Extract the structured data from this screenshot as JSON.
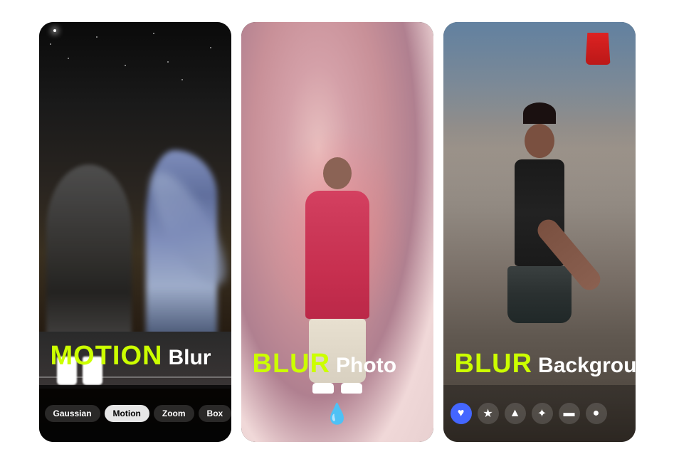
{
  "cards": [
    {
      "id": "card-motion-blur",
      "title_accent": "MOTION",
      "title_normal": "Blur",
      "tabs": [
        {
          "label": "Gaussian",
          "active": false
        },
        {
          "label": "Motion",
          "active": true
        },
        {
          "label": "Zoom",
          "active": false
        },
        {
          "label": "Box",
          "active": false
        }
      ]
    },
    {
      "id": "card-blur-photo",
      "title_accent": "BLUR",
      "title_normal": "Photo",
      "bottom_icon": "droplet"
    },
    {
      "id": "card-blur-background",
      "title_accent": "BLUR",
      "title_normal": "Background",
      "bottom_icons": [
        {
          "name": "heart",
          "symbol": "♥"
        },
        {
          "name": "star",
          "symbol": "★"
        },
        {
          "name": "triangle",
          "symbol": "▲"
        },
        {
          "name": "game",
          "symbol": "✦"
        },
        {
          "name": "rect",
          "symbol": "▬"
        },
        {
          "name": "cloud",
          "symbol": "●"
        }
      ]
    }
  ],
  "colors": {
    "accent_green": "#ccff00",
    "white": "#ffffff"
  }
}
